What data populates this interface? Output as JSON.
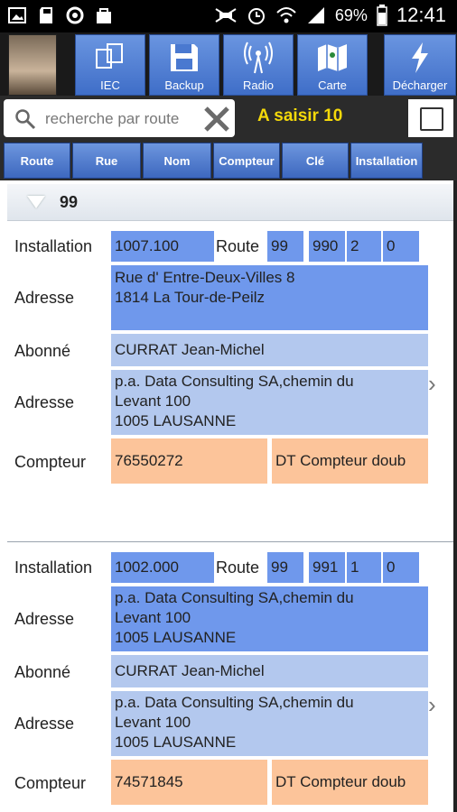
{
  "status_bar": {
    "battery": "69%",
    "time": "12:41",
    "icons": [
      "gallery-icon",
      "sd-card-icon",
      "sync-icon",
      "bag-icon",
      "mute-icon",
      "alarm-icon",
      "wifi-icon",
      "signal-icon",
      "battery-icon"
    ]
  },
  "toolbar": {
    "buttons": [
      {
        "label": "IEC",
        "icon": "copy-icon"
      },
      {
        "label": "Backup",
        "icon": "save-icon"
      },
      {
        "label": "Radio",
        "icon": "radio-icon"
      },
      {
        "label": "Carte",
        "icon": "map-icon"
      },
      {
        "label": "Décharger",
        "icon": "lightning-icon"
      }
    ]
  },
  "search": {
    "placeholder": "recherche par route"
  },
  "saisir_label": "A saisir 10",
  "columns": [
    "Route",
    "Rue",
    "Nom",
    "Compteur",
    "Clé",
    "Installation"
  ],
  "group": {
    "title": "99"
  },
  "records": [
    {
      "installation_label": "Installation",
      "installation": "1007.100",
      "route_label": "Route",
      "route": [
        "99",
        "990",
        "2",
        "0"
      ],
      "adresse_label": "Adresse",
      "adresse": [
        "Rue d' Entre-Deux-Villes 8",
        "1814 La Tour-de-Peilz"
      ],
      "abonne_label": "Abonné",
      "abonne": "CURRAT Jean-Michel",
      "adresse2_label": "Adresse",
      "adresse2": [
        "p.a. Data Consulting SA,chemin du",
        "Levant 100",
        "1005 LAUSANNE"
      ],
      "compteur_label": "Compteur",
      "compteur": "76550272",
      "compteur_type": "DT Compteur doub"
    },
    {
      "installation_label": "Installation",
      "installation": "1002.000",
      "route_label": "Route",
      "route": [
        "99",
        "991",
        "1",
        "0"
      ],
      "adresse_label": "Adresse",
      "adresse": [
        "p.a. Data Consulting SA,chemin du",
        "Levant 100",
        "1005 LAUSANNE"
      ],
      "abonne_label": "Abonné",
      "abonne": "CURRAT Jean-Michel",
      "adresse2_label": "Adresse",
      "adresse2": [
        "p.a. Data Consulting SA,chemin du",
        "Levant 100",
        "1005 LAUSANNE"
      ],
      "compteur_label": "Compteur",
      "compteur": "74571845",
      "compteur_type": "DT Compteur doub"
    }
  ]
}
